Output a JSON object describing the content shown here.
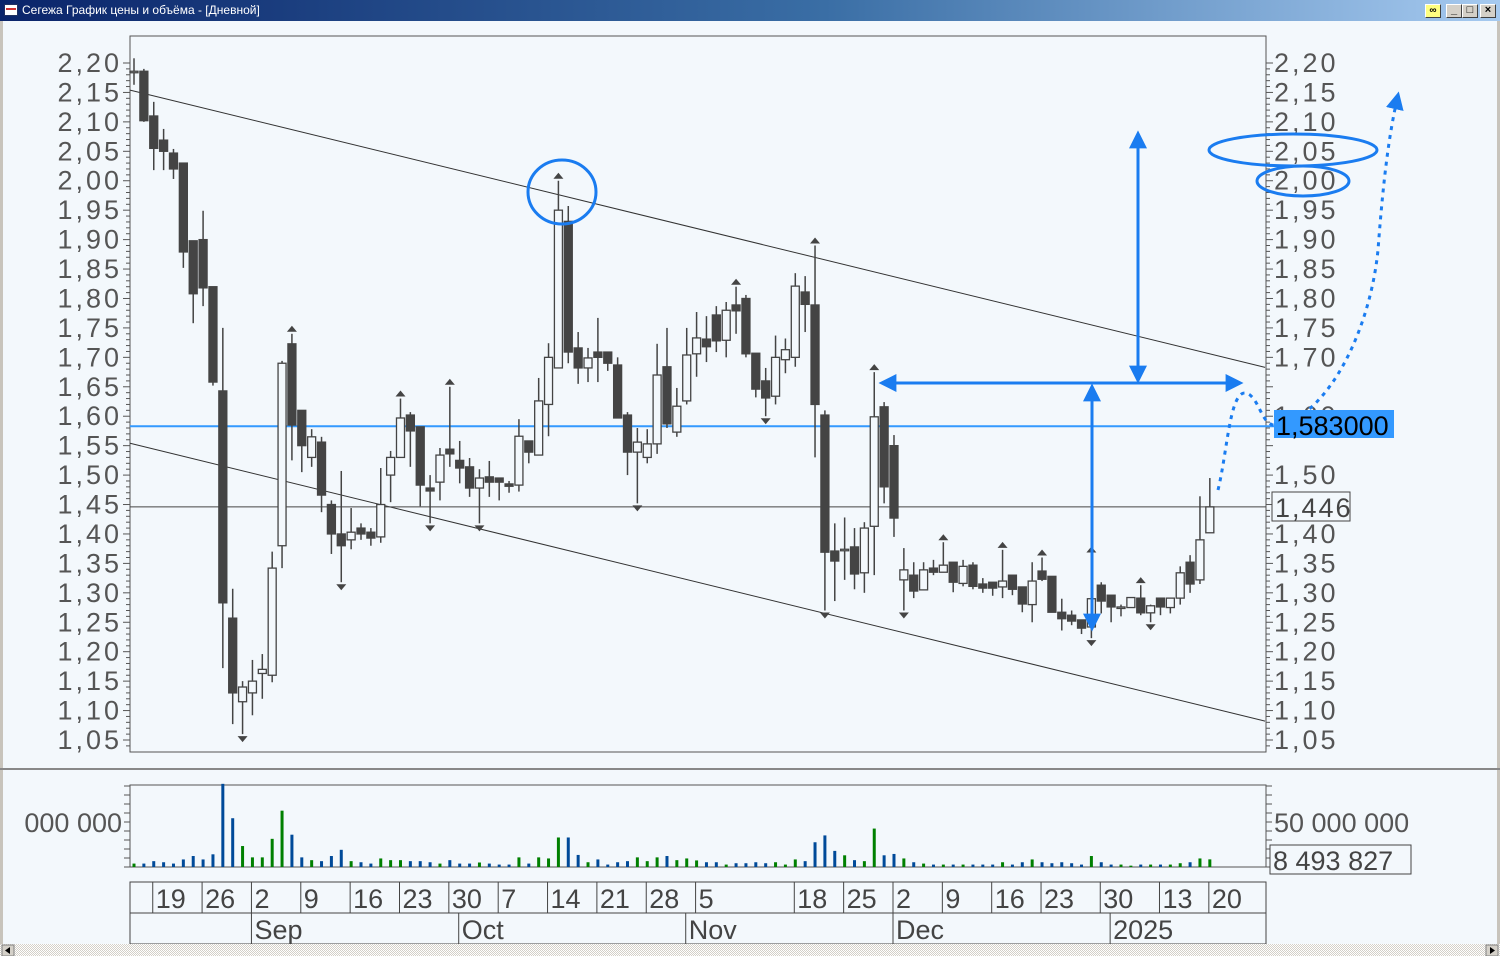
{
  "window": {
    "title": "Сегежа График цены и объёма - [Дневной]",
    "link_icon": "link-icon",
    "minimize_label": "_",
    "maximize_label": "□",
    "close_label": "×"
  },
  "colors": {
    "bg": "#f3f8fc",
    "candle": "#444444",
    "annotation": "#1a7cf0",
    "price_line": "#3399ff",
    "vol_up": "#008000",
    "vol_down": "#004a99"
  },
  "price_labels": {
    "current_line": "1,583000",
    "last_close": "1,446"
  },
  "volume_labels": {
    "axis_left": "000  000",
    "axis_right": "50  000  000",
    "last": "8  493  827"
  },
  "chart_data": {
    "type": "candlestick",
    "title": "Сегежа График цены и объёма - [Дневной]",
    "ylim": [
      1.05,
      2.2
    ],
    "y_ticks": [
      "2,20",
      "2,15",
      "2,10",
      "2,05",
      "2,00",
      "1,95",
      "1,90",
      "1,85",
      "1,80",
      "1,75",
      "1,70",
      "1,65",
      "1,60",
      "1,55",
      "1,50",
      "1,45",
      "1,40",
      "1,35",
      "1,30",
      "1,25",
      "1,20",
      "1,15",
      "1,10",
      "1,05"
    ],
    "y_tick_values": [
      2.2,
      2.15,
      2.1,
      2.05,
      2.0,
      1.95,
      1.9,
      1.85,
      1.8,
      1.75,
      1.7,
      1.65,
      1.6,
      1.55,
      1.5,
      1.45,
      1.4,
      1.35,
      1.3,
      1.25,
      1.2,
      1.15,
      1.1,
      1.05
    ],
    "x_ticks": [
      {
        "label": "19",
        "bar": 2
      },
      {
        "label": "26",
        "bar": 7
      },
      {
        "label": "2",
        "bar": 12
      },
      {
        "label": "9",
        "bar": 17
      },
      {
        "label": "16",
        "bar": 22
      },
      {
        "label": "23",
        "bar": 27
      },
      {
        "label": "30",
        "bar": 32
      },
      {
        "label": "7",
        "bar": 37
      },
      {
        "label": "14",
        "bar": 42
      },
      {
        "label": "21",
        "bar": 47
      },
      {
        "label": "28",
        "bar": 52
      },
      {
        "label": "5",
        "bar": 57
      },
      {
        "label": "18",
        "bar": 67
      },
      {
        "label": "25",
        "bar": 72
      },
      {
        "label": "2",
        "bar": 77
      },
      {
        "label": "9",
        "bar": 82
      },
      {
        "label": "16",
        "bar": 87
      },
      {
        "label": "23",
        "bar": 92
      },
      {
        "label": "30",
        "bar": 98
      },
      {
        "label": "13",
        "bar": 104
      },
      {
        "label": "20",
        "bar": 109
      }
    ],
    "months": [
      {
        "label": "Sep",
        "bar": 12
      },
      {
        "label": "Oct",
        "bar": 33
      },
      {
        "label": "Nov",
        "bar": 56
      },
      {
        "label": "Dec",
        "bar": 77
      },
      {
        "label": "2025",
        "bar": 99
      }
    ],
    "ohlc": [
      [
        2.186,
        2.208,
        2.163,
        2.186
      ],
      [
        2.186,
        2.19,
        2.1,
        2.102
      ],
      [
        2.11,
        2.134,
        2.018,
        2.055
      ],
      [
        2.069,
        2.088,
        2.018,
        2.05
      ],
      [
        2.047,
        2.054,
        2.003,
        2.02
      ],
      [
        2.03,
        2.03,
        1.852,
        1.879
      ],
      [
        1.898,
        1.898,
        1.758,
        1.808
      ],
      [
        1.9,
        1.949,
        1.787,
        1.818
      ],
      [
        1.82,
        1.82,
        1.652,
        1.658
      ],
      [
        1.643,
        1.75,
        1.172,
        1.283
      ],
      [
        1.257,
        1.307,
        1.077,
        1.13
      ],
      [
        1.115,
        1.15,
        1.06,
        1.14
      ],
      [
        1.13,
        1.186,
        1.092,
        1.15
      ],
      [
        1.163,
        1.196,
        1.12,
        1.17
      ],
      [
        1.16,
        1.37,
        1.148,
        1.342
      ],
      [
        1.38,
        1.694,
        1.342,
        1.69
      ],
      [
        1.723,
        1.74,
        1.525,
        1.585
      ],
      [
        1.61,
        1.61,
        1.505,
        1.55
      ],
      [
        1.53,
        1.578,
        1.514,
        1.565
      ],
      [
        1.556,
        1.565,
        1.437,
        1.466
      ],
      [
        1.45,
        1.457,
        1.366,
        1.4
      ],
      [
        1.4,
        1.507,
        1.318,
        1.38
      ],
      [
        1.39,
        1.444,
        1.374,
        1.403
      ],
      [
        1.41,
        1.418,
        1.39,
        1.4
      ],
      [
        1.403,
        1.41,
        1.38,
        1.393
      ],
      [
        1.395,
        1.512,
        1.385,
        1.45
      ],
      [
        1.5,
        1.541,
        1.454,
        1.53
      ],
      [
        1.53,
        1.63,
        1.53,
        1.597
      ],
      [
        1.602,
        1.607,
        1.514,
        1.575
      ],
      [
        1.582,
        1.582,
        1.447,
        1.483
      ],
      [
        1.478,
        1.5,
        1.418,
        1.473
      ],
      [
        1.488,
        1.546,
        1.457,
        1.534
      ],
      [
        1.544,
        1.65,
        1.514,
        1.536
      ],
      [
        1.525,
        1.558,
        1.486,
        1.512
      ],
      [
        1.514,
        1.529,
        1.463,
        1.478
      ],
      [
        1.478,
        1.51,
        1.418,
        1.495
      ],
      [
        1.497,
        1.524,
        1.463,
        1.488
      ],
      [
        1.495,
        1.495,
        1.457,
        1.488
      ],
      [
        1.485,
        1.49,
        1.47,
        1.481
      ],
      [
        1.483,
        1.595,
        1.472,
        1.566
      ],
      [
        1.558,
        1.558,
        1.52,
        1.539
      ],
      [
        1.534,
        1.665,
        1.534,
        1.626
      ],
      [
        1.62,
        1.724,
        1.566,
        1.7
      ],
      [
        1.682,
        2.0,
        1.682,
        1.95
      ],
      [
        1.931,
        1.957,
        1.69,
        1.709
      ],
      [
        1.716,
        1.743,
        1.655,
        1.682
      ],
      [
        1.682,
        1.716,
        1.658,
        1.699
      ],
      [
        1.709,
        1.767,
        1.658,
        1.7
      ],
      [
        1.709,
        1.709,
        1.677,
        1.69
      ],
      [
        1.687,
        1.7,
        1.597,
        1.597
      ],
      [
        1.602,
        1.607,
        1.5,
        1.539
      ],
      [
        1.539,
        1.58,
        1.452,
        1.556
      ],
      [
        1.53,
        1.578,
        1.52,
        1.553
      ],
      [
        1.553,
        1.723,
        1.536,
        1.67
      ],
      [
        1.684,
        1.75,
        1.58,
        1.587
      ],
      [
        1.573,
        1.648,
        1.565,
        1.617
      ],
      [
        1.626,
        1.75,
        1.62,
        1.704
      ],
      [
        1.706,
        1.777,
        1.667,
        1.733
      ],
      [
        1.731,
        1.77,
        1.692,
        1.718
      ],
      [
        1.772,
        1.787,
        1.709,
        1.728
      ],
      [
        1.729,
        1.794,
        1.7,
        1.78
      ],
      [
        1.789,
        1.82,
        1.74,
        1.779
      ],
      [
        1.8,
        1.806,
        1.7,
        1.706
      ],
      [
        1.707,
        1.707,
        1.632,
        1.646
      ],
      [
        1.66,
        1.682,
        1.6,
        1.631
      ],
      [
        1.634,
        1.737,
        1.62,
        1.7
      ],
      [
        1.696,
        1.732,
        1.673,
        1.713
      ],
      [
        1.7,
        1.843,
        1.684,
        1.821
      ],
      [
        1.811,
        1.838,
        1.743,
        1.79
      ],
      [
        1.789,
        1.89,
        1.53,
        1.62
      ],
      [
        1.602,
        1.61,
        1.27,
        1.369
      ],
      [
        1.371,
        1.418,
        1.286,
        1.354
      ],
      [
        1.372,
        1.428,
        1.322,
        1.374
      ],
      [
        1.378,
        1.41,
        1.306,
        1.332
      ],
      [
        1.334,
        1.42,
        1.3,
        1.41
      ],
      [
        1.413,
        1.675,
        1.33,
        1.599
      ],
      [
        1.616,
        1.624,
        1.452,
        1.48
      ],
      [
        1.55,
        1.568,
        1.395,
        1.427
      ],
      [
        1.322,
        1.376,
        1.27,
        1.339
      ],
      [
        1.33,
        1.352,
        1.291,
        1.303
      ],
      [
        1.305,
        1.352,
        1.305,
        1.339
      ],
      [
        1.342,
        1.356,
        1.33,
        1.335
      ],
      [
        1.335,
        1.386,
        1.335,
        1.347
      ],
      [
        1.352,
        1.352,
        1.301,
        1.318
      ],
      [
        1.316,
        1.356,
        1.311,
        1.345
      ],
      [
        1.347,
        1.352,
        1.306,
        1.311
      ],
      [
        1.315,
        1.325,
        1.3,
        1.308
      ],
      [
        1.318,
        1.318,
        1.295,
        1.308
      ],
      [
        1.31,
        1.373,
        1.291,
        1.32
      ],
      [
        1.33,
        1.33,
        1.296,
        1.306
      ],
      [
        1.31,
        1.31,
        1.267,
        1.281
      ],
      [
        1.28,
        1.352,
        1.25,
        1.32
      ],
      [
        1.337,
        1.36,
        1.32,
        1.323
      ],
      [
        1.328,
        1.328,
        1.267,
        1.267
      ],
      [
        1.267,
        1.29,
        1.236,
        1.256
      ],
      [
        1.262,
        1.27,
        1.245,
        1.252
      ],
      [
        1.254,
        1.254,
        1.23,
        1.24
      ],
      [
        1.242,
        1.365,
        1.223,
        1.29
      ],
      [
        1.313,
        1.318,
        1.265,
        1.286
      ],
      [
        1.296,
        1.296,
        1.25,
        1.276
      ],
      [
        1.276,
        1.28,
        1.26,
        1.276
      ],
      [
        1.275,
        1.292,
        1.275,
        1.292
      ],
      [
        1.291,
        1.313,
        1.262,
        1.266
      ],
      [
        1.266,
        1.28,
        1.25,
        1.278
      ],
      [
        1.291,
        1.291,
        1.262,
        1.276
      ],
      [
        1.275,
        1.291,
        1.265,
        1.291
      ],
      [
        1.291,
        1.345,
        1.28,
        1.334
      ],
      [
        1.352,
        1.364,
        1.3,
        1.315
      ],
      [
        1.322,
        1.464,
        1.315,
        1.39
      ],
      [
        1.402,
        1.495,
        1.402,
        1.446
      ]
    ],
    "high_markers": [
      16,
      27,
      32,
      43,
      61,
      69,
      75,
      82,
      88,
      92,
      97,
      102
    ],
    "low_markers": [
      11,
      21,
      30,
      35,
      51,
      64,
      70,
      78,
      97,
      103
    ],
    "volume_millions": [
      3.8,
      3.8,
      6.5,
      5.3,
      3.8,
      8.4,
      12.2,
      8.4,
      14.1,
      92.4,
      54.2,
      23.3,
      10.7,
      10.7,
      31.3,
      62.6,
      35.9,
      10.7,
      7.6,
      6.5,
      12.2,
      19.1,
      6.5,
      5.3,
      3.8,
      9.5,
      7.6,
      7.6,
      6.5,
      6.5,
      5.3,
      3.8,
      7.6,
      3.8,
      3.8,
      5.0,
      3.8,
      2.7,
      2.7,
      10.7,
      3.8,
      10.7,
      9.5,
      32.8,
      32.8,
      13.4,
      5.3,
      8.4,
      2.7,
      5.3,
      6.5,
      10.7,
      6.5,
      10.7,
      12.2,
      7.6,
      9.5,
      7.3,
      5.3,
      5.3,
      2.7,
      4.2,
      4.2,
      5.3,
      4.2,
      5.3,
      2.7,
      8.4,
      6.5,
      27.5,
      35.1,
      17.9,
      13,
      7.6,
      6.5,
      42.7,
      13,
      14.5,
      9.5,
      5.3,
      3.8,
      2.7,
      2.7,
      2.7,
      2.7,
      2.7,
      2.7,
      2.7,
      5.3,
      2.7,
      5.3,
      8.4,
      5.3,
      4.2,
      5.3,
      4.2,
      2.7,
      12.2,
      5.3,
      2.7,
      2.7,
      1.5,
      2.7,
      2.7,
      2.7,
      2.7,
      4.2,
      5.3,
      9.5,
      8.49
    ],
    "volume_axis_value": 50000000,
    "trendlines": [
      {
        "name": "upper-channel",
        "from": {
          "bar": -0.4,
          "price": 2.154
        },
        "to": {
          "bar": 114.6,
          "price": 1.683
        }
      },
      {
        "name": "lower-channel",
        "from": {
          "bar": -0.4,
          "price": 1.554
        },
        "to": {
          "bar": 114.6,
          "price": 1.082
        }
      }
    ],
    "horizontal_lines": [
      {
        "name": "current-price-line",
        "price": 1.583
      },
      {
        "name": "last-close-line",
        "price": 1.446
      }
    ]
  }
}
